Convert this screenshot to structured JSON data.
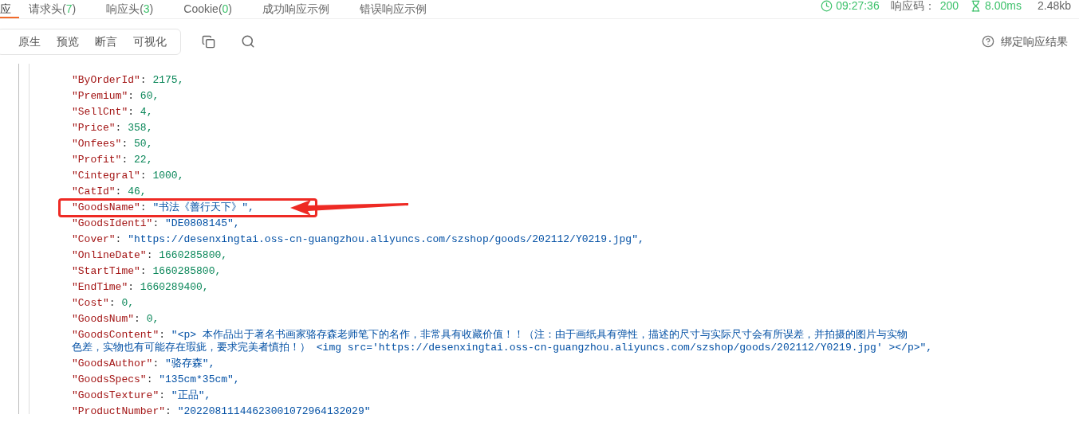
{
  "tabs": [
    {
      "label": "应",
      "selected": true
    },
    {
      "label": "请求头",
      "open": "(",
      "count": "7",
      "close": ")",
      "selected": false
    },
    {
      "label": "响应头",
      "open": "(",
      "count": "3",
      "close": ")",
      "selected": false
    },
    {
      "label": "Cookie",
      "open": "(",
      "count": "0",
      "close": ")",
      "selected": false
    },
    {
      "label": "成功响应示例",
      "selected": false
    },
    {
      "label": "错误响应示例",
      "selected": false
    }
  ],
  "status": {
    "time": "09:27:36",
    "code_label": "响应码：",
    "code": "200",
    "duration": "8.00ms",
    "size": "2.48kb"
  },
  "view_modes": [
    {
      "label": "原生",
      "selected": false
    },
    {
      "label": "预览",
      "selected": false
    },
    {
      "label": "断言",
      "selected": false
    },
    {
      "label": "可视化",
      "selected": false
    }
  ],
  "bind_result": "绑定响应结果",
  "lines": [
    {
      "key": "\"ByOrderId\"",
      "sep": ":",
      "kind": "number",
      "value": [
        "2175,"
      ]
    },
    {
      "key": "\"Premium\"",
      "sep": ":",
      "kind": "number",
      "value": [
        "60,"
      ]
    },
    {
      "key": "\"SellCnt\"",
      "sep": ":",
      "kind": "number",
      "value": [
        "4,"
      ]
    },
    {
      "key": "\"Price\"",
      "sep": ":",
      "kind": "number",
      "value": [
        "358,"
      ]
    },
    {
      "key": "\"Onfees\"",
      "sep": ":",
      "kind": "number",
      "value": [
        "50,"
      ]
    },
    {
      "key": "\"Profit\"",
      "sep": ":",
      "kind": "number",
      "value": [
        "22,"
      ]
    },
    {
      "key": "\"Cintegral\"",
      "sep": ":",
      "kind": "number",
      "value": [
        "1000,"
      ]
    },
    {
      "key": "\"CatId\"",
      "sep": ":",
      "kind": "number",
      "value": [
        "46,"
      ]
    },
    {
      "key": "\"GoodsName\"",
      "sep": ":",
      "kind": "string",
      "value": [
        "\"书法《善行天下》\","
      ]
    },
    {
      "key": "\"GoodsIdenti\"",
      "sep": ":",
      "kind": "string",
      "value": [
        "\"DE0808145\","
      ]
    },
    {
      "key": "\"Cover\"",
      "sep": ":",
      "kind": "string",
      "value": [
        "\"https://desenxingtai.oss-cn-guangzhou.aliyuncs.com/szshop/goods/202112/Y0219.jpg\","
      ]
    },
    {
      "key": "\"OnlineDate\"",
      "sep": ":",
      "kind": "number",
      "value": [
        "1660285800,"
      ]
    },
    {
      "key": "\"StartTime\"",
      "sep": ":",
      "kind": "number",
      "value": [
        "1660285800,"
      ]
    },
    {
      "key": "\"EndTime\"",
      "sep": ":",
      "kind": "number",
      "value": [
        "1660289400,"
      ]
    },
    {
      "key": "\"Cost\"",
      "sep": ":",
      "kind": "number",
      "value": [
        "0,"
      ]
    },
    {
      "key": "\"GoodsNum\"",
      "sep": ":",
      "kind": "number",
      "value": [
        "0,"
      ]
    },
    {
      "key": "\"GoodsContent\"",
      "sep": ":",
      "kind": "string",
      "value": [
        "\"<p> 本作品出于著名书画家骆存森老师笔下的名作，非常具有收藏价值！！（注：由于画纸具有弹性，描述的尺寸与实际尺寸会有所误差，并拍摄的图片与实物",
        "色差，实物也有可能存在瑕疵，要求完美者慎拍！） <img src='https://desenxingtai.oss-cn-guangzhou.aliyuncs.com/szshop/goods/202112/Y0219.jpg' ></p>\","
      ]
    },
    {
      "key": "\"GoodsAuthor\"",
      "sep": ":",
      "kind": "string",
      "value": [
        "\"骆存森\","
      ]
    },
    {
      "key": "\"GoodsSpecs\"",
      "sep": ":",
      "kind": "string",
      "value": [
        "\"135cm*35cm\","
      ]
    },
    {
      "key": "\"GoodsTexture\"",
      "sep": ":",
      "kind": "string",
      "value": [
        "\"正品\","
      ]
    },
    {
      "key": "\"ProductNumber\"",
      "sep": ":",
      "kind": "string",
      "value": [
        "\"20220811144623001072964132029\""
      ]
    }
  ]
}
